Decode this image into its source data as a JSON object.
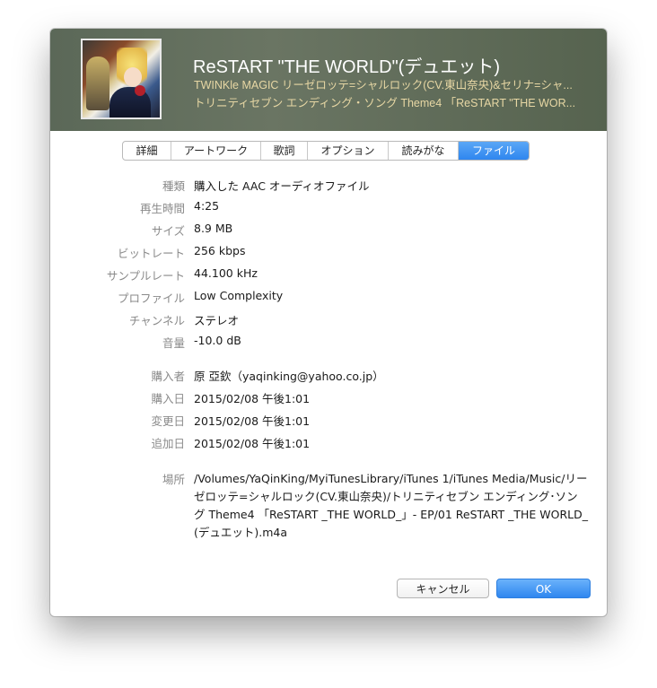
{
  "header": {
    "title": "ReSTART \"THE WORLD\"(デュエット)",
    "artist": "TWINKle MAGIC リーゼロッテ=シャルロック(CV.東山奈央)&セリナ=シャ...",
    "album": "トリニティセブン エンディング・ソング Theme4 「ReSTART \"THE WOR..."
  },
  "tabs": [
    {
      "label": "詳細",
      "active": false
    },
    {
      "label": "アートワーク",
      "active": false
    },
    {
      "label": "歌詞",
      "active": false
    },
    {
      "label": "オプション",
      "active": false
    },
    {
      "label": "読みがな",
      "active": false
    },
    {
      "label": "ファイル",
      "active": true
    }
  ],
  "file_info": {
    "kind": {
      "label": "種類",
      "value": "購入した AAC オーディオファイル"
    },
    "duration": {
      "label": "再生時間",
      "value": "4:25"
    },
    "size": {
      "label": "サイズ",
      "value": "8.9 MB"
    },
    "bitrate": {
      "label": "ビットレート",
      "value": "256 kbps"
    },
    "samplerate": {
      "label": "サンプルレート",
      "value": "44.100 kHz"
    },
    "profile": {
      "label": "プロファイル",
      "value": "Low Complexity"
    },
    "channels": {
      "label": "チャンネル",
      "value": "ステレオ"
    },
    "volume": {
      "label": "音量",
      "value": "-10.0 dB"
    },
    "purchaser": {
      "label": "購入者",
      "value": "原 亞欽（yaqinking@yahoo.co.jp）"
    },
    "purchase_date": {
      "label": "購入日",
      "value": "2015/02/08 午後1:01"
    },
    "modified_date": {
      "label": "変更日",
      "value": "2015/02/08 午後1:01"
    },
    "added_date": {
      "label": "追加日",
      "value": "2015/02/08 午後1:01"
    },
    "location": {
      "label": "場所",
      "value": "/Volumes/YaQinKing/MyiTunesLibrary/iTunes 1/iTunes Media/Music/リーゼロッテ=シャルロック(CV.東山奈央)/トリニティセブン エンディング･ソング Theme4 「ReSTART _THE WORLD_」- EP/01 ReSTART _THE WORLD_(デュエット).m4a"
    }
  },
  "buttons": {
    "cancel": "キャンセル",
    "ok": "OK"
  },
  "colors": {
    "accent": "#2f86ef",
    "header_bg": "#5f6b5b",
    "subtitle": "#e7d7a4"
  }
}
